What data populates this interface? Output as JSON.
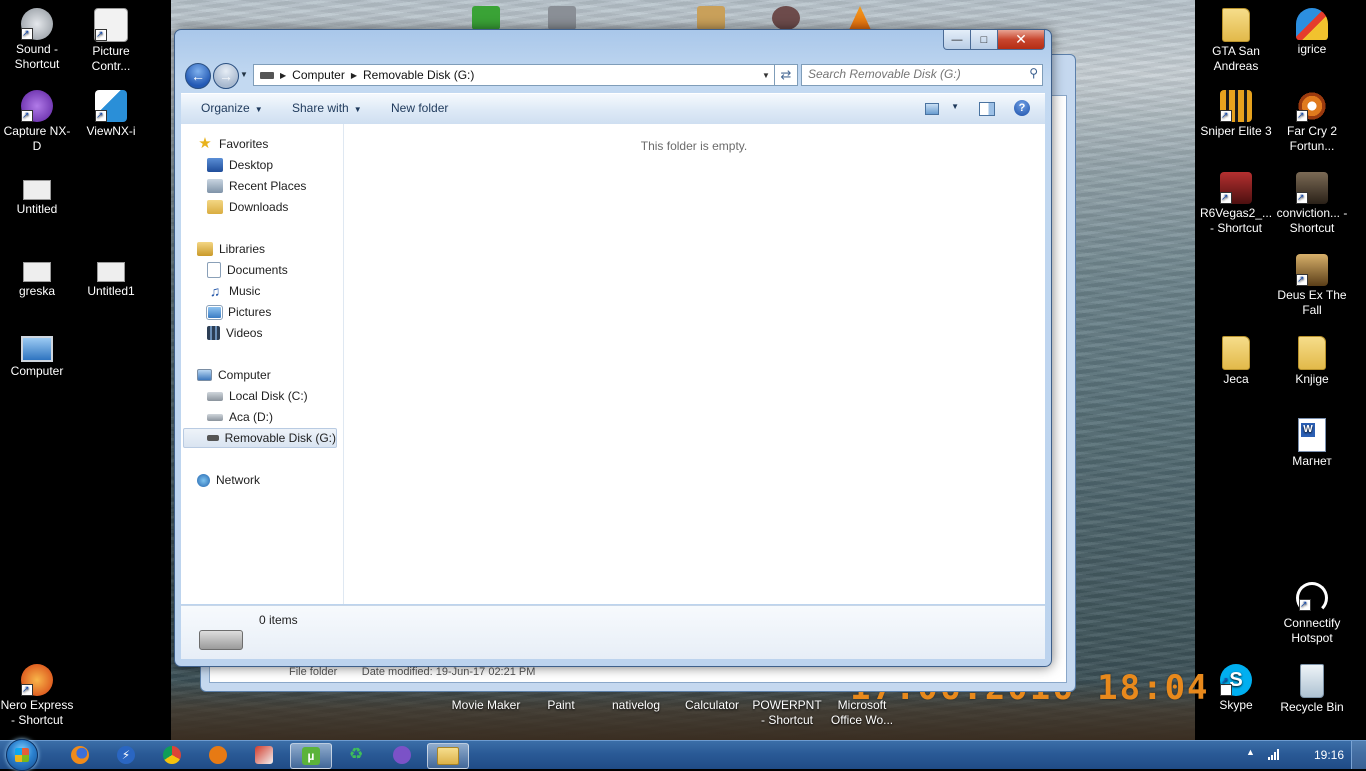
{
  "desktop": {
    "icons_left": [
      {
        "label": "Sound - Shortcut",
        "icon": "speaker-icon",
        "color": "#c9cdd2"
      },
      {
        "label": "Picture Contr...",
        "icon": "nikon-picture-control-icon",
        "color": "#f2f2f2"
      },
      {
        "label": "Capture NX-D",
        "icon": "capture-nx-icon",
        "color": "#6b2fb5"
      },
      {
        "label": "ViewNX-i",
        "icon": "viewnx-icon",
        "color": "#2a8fd8"
      },
      {
        "label": "Untitled",
        "icon": "document-icon",
        "color": "#e8e8e8"
      },
      {
        "label": "greska",
        "icon": "document-icon",
        "color": "#e8e8e8"
      },
      {
        "label": "Untitled1",
        "icon": "document-icon",
        "color": "#e8e8e8"
      },
      {
        "label": "Computer",
        "icon": "computer-icon",
        "color": "#4a8fd6"
      },
      {
        "label": "Nero Express - Shortcut",
        "icon": "nero-icon",
        "color": "#e0491a"
      }
    ],
    "icons_right": [
      {
        "label": "GTA San Andreas",
        "icon": "folder-icon",
        "color": "#e9c65a"
      },
      {
        "label": "igrice",
        "icon": "butterfly-icon",
        "color": "#d8402e"
      },
      {
        "label": "Sniper Elite 3",
        "icon": "sniper-elite-icon",
        "color": "#d99a1c"
      },
      {
        "label": "Far Cry 2 Fortun...",
        "icon": "far-cry-icon",
        "color": "#e07a1d"
      },
      {
        "label": "R6Vegas2_... - Shortcut",
        "icon": "game-icon",
        "color": "#8a1f1f"
      },
      {
        "label": "conviction... - Shortcut",
        "icon": "game-icon",
        "color": "#4b3a2a"
      },
      {
        "label": "Deus Ex The Fall",
        "icon": "game-icon",
        "color": "#a9803a"
      },
      {
        "label": "Jeca",
        "icon": "folder-icon",
        "color": "#e9c65a"
      },
      {
        "label": "Knjige",
        "icon": "folder-icon",
        "color": "#e9c65a"
      },
      {
        "label": "Магнет",
        "icon": "word-document-icon",
        "color": "#2b5fb4"
      },
      {
        "label": "Connectify Hotspot",
        "icon": "wifi-icon",
        "color": "#ffffff"
      },
      {
        "label": "Skype",
        "icon": "skype-icon",
        "color": "#00aff0"
      },
      {
        "label": "Recycle Bin",
        "icon": "recycle-bin-icon",
        "color": "#d7e4ee"
      }
    ],
    "icons_bottom": [
      {
        "label": "Movie Maker"
      },
      {
        "label": "Paint"
      },
      {
        "label": "nativelog"
      },
      {
        "label": "Calculator"
      },
      {
        "label": "POWERPNT - Shortcut"
      },
      {
        "label": "Microsoft Office Wo..."
      }
    ],
    "date_stamp": "17.06.2016  18:04"
  },
  "back_window": {
    "footer_type": "File folder",
    "footer_modified": "Date modified: 19-Jun-17 02:21 PM"
  },
  "window": {
    "caption": {
      "min": "—",
      "max": "□",
      "close": "✕"
    },
    "address": {
      "crumbs": [
        "Computer",
        "Removable Disk (G:)"
      ]
    },
    "search_placeholder": "Search Removable Disk (G:)",
    "toolbar": {
      "organize": "Organize",
      "share_with": "Share with",
      "new_folder": "New folder",
      "help": "?"
    },
    "nav": {
      "favorites": "Favorites",
      "desktop": "Desktop",
      "recent_places": "Recent Places",
      "downloads": "Downloads",
      "libraries": "Libraries",
      "documents": "Documents",
      "music": "Music",
      "pictures": "Pictures",
      "videos": "Videos",
      "computer": "Computer",
      "local_disk": "Local Disk (C:)",
      "aca": "Aca (D:)",
      "removable": "Removable Disk (G:)",
      "network": "Network"
    },
    "empty_message": "This folder is empty.",
    "details": {
      "item_count": "0 items"
    }
  },
  "taskbar": {
    "pinned": [
      "firefox-icon",
      "flash-icon",
      "chrome-icon",
      "vlc-icon",
      "tools-icon",
      "utorrent-icon",
      "recycle-arrows-icon",
      "viber-icon",
      "explorer-icon"
    ],
    "active_app": "explorer-icon",
    "clock": "19:16"
  },
  "colors": {
    "accent": "#2a5a96",
    "selection": "#d9e4f1",
    "date_stamp": "#e8891c"
  }
}
